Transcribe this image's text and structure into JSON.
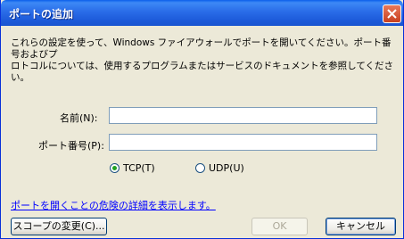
{
  "window": {
    "title": "ポートの追加"
  },
  "description": "これらの設定を使って、Windows ファイアウォールでポートを開いてください。ポート番号およびプ\nロトコルについては、使用するプログラムまたはサービスのドキュメントを参照してください。",
  "form": {
    "name_label": "名前(N):",
    "name_value": "",
    "port_label": "ポート番号(P):",
    "port_value": ""
  },
  "protocol": {
    "options": [
      {
        "label": "TCP(T)",
        "selected": true
      },
      {
        "label": "UDP(U)",
        "selected": false
      }
    ]
  },
  "risk_link": "ポートを開くことの危険の詳細を表示します。",
  "buttons": {
    "scope": "スコープの変更(C)...",
    "ok": "OK",
    "cancel": "キャンセル"
  },
  "colors": {
    "titlebar": "#2A6CE8",
    "dialog_bg": "#ECE9D8",
    "link": "#0000FF",
    "radio_dot": "#21A121"
  }
}
